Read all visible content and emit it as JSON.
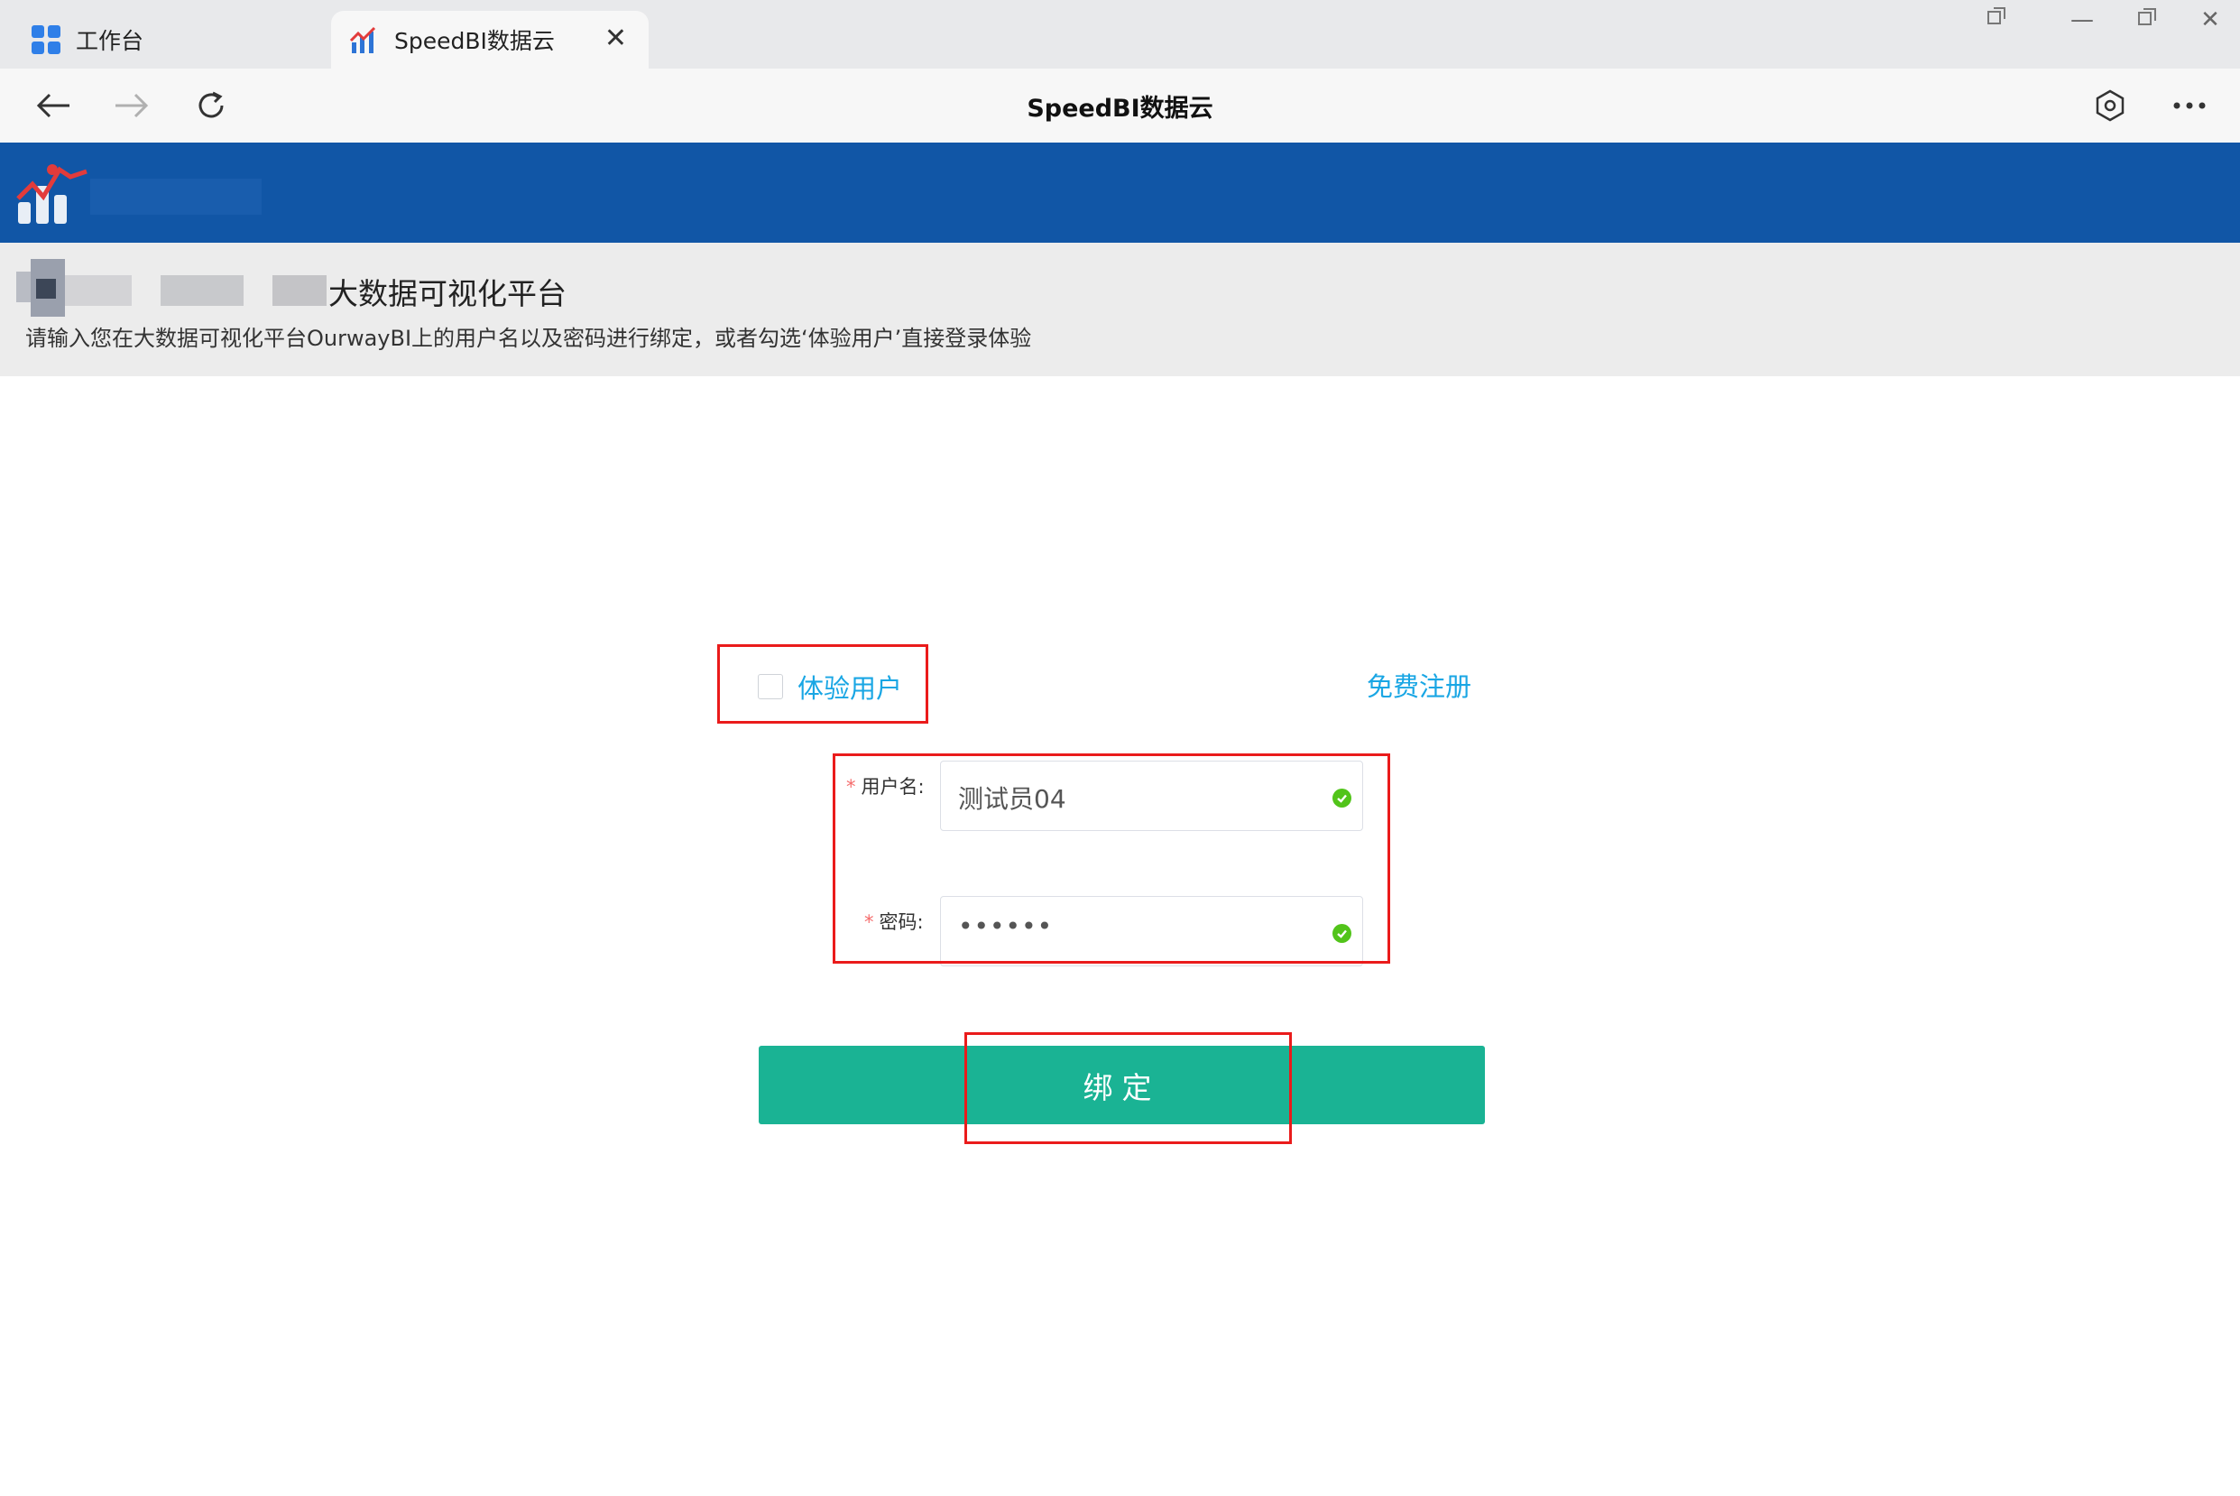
{
  "browser": {
    "tabs": [
      {
        "label": "工作台"
      },
      {
        "label": "SpeedBI数据云"
      }
    ],
    "page_title": "SpeedBI数据云"
  },
  "header": {
    "title": "大数据可视化平台",
    "description": "请输入您在大数据可视化平台OurwayBI上的用户名以及密码进行绑定，或者勾选‘体验用户’直接登录体验"
  },
  "form": {
    "trial_label": "体验用户",
    "trial_checked": false,
    "register_label": "免费注册",
    "username_label": "用户名:",
    "username_value": "测试员04",
    "password_label": "密码:",
    "password_value": "••••••",
    "submit_label": "绑定"
  },
  "colors": {
    "brand_blue": "#1156a6",
    "link_blue": "#19a6e4",
    "submit_green": "#1ab394",
    "valid_green": "#52c41a",
    "highlight_red": "#ea1b1b"
  }
}
